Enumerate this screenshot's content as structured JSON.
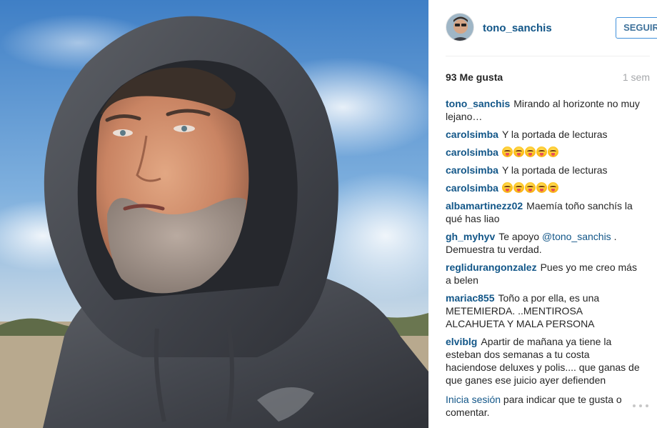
{
  "post": {
    "username": "tono_sanchis",
    "follow_label": "SEGUIR",
    "likes": "93 Me gusta",
    "age": "1 sem"
  },
  "comments": [
    {
      "user": "tono_sanchis",
      "text": "Mirando al horizonte no muy lejano…",
      "emoji_count": 0
    },
    {
      "user": "carolsimba",
      "text": "Y la portada de lecturas",
      "emoji_count": 0
    },
    {
      "user": "carolsimba",
      "text": "",
      "emoji_count": 5
    },
    {
      "user": "carolsimba",
      "text": "Y la portada de lecturas",
      "emoji_count": 0
    },
    {
      "user": "carolsimba",
      "text": "",
      "emoji_count": 5
    },
    {
      "user": "albamartinezz02",
      "text": "Maemía toño sanchís la qué has liao",
      "emoji_count": 0
    },
    {
      "user": "gh_myhyv",
      "text_before": "Te apoyo",
      "mention": "@tono_sanchis",
      "text_after": ". Demuestra tu verdad.",
      "emoji_count": 0
    },
    {
      "user": "reglidurangonzalez",
      "text": "Pues yo me creo más a belen",
      "emoji_count": 0
    },
    {
      "user": "mariac855",
      "text": "Toño a por ella, es una METEMIERDA. ..MENTIROSA ALCAHUETA Y MALA PERSONA",
      "emoji_count": 0
    },
    {
      "user": "elviblg",
      "text": "Apartir de mañana ya tiene la esteban dos semanas a tu costa haciendose deluxes y polis.... que ganas de que ganes ese juicio ayer defienden",
      "emoji_count": 0
    }
  ],
  "footer": {
    "login_link": "Inicia sesión",
    "login_text": " para indicar que te gusta o comentar.",
    "more_icon": "ellipsis-icon"
  },
  "colors": {
    "link": "#125688",
    "follow_border": "#4090db",
    "text": "#262626",
    "muted": "#a5a7aa"
  }
}
